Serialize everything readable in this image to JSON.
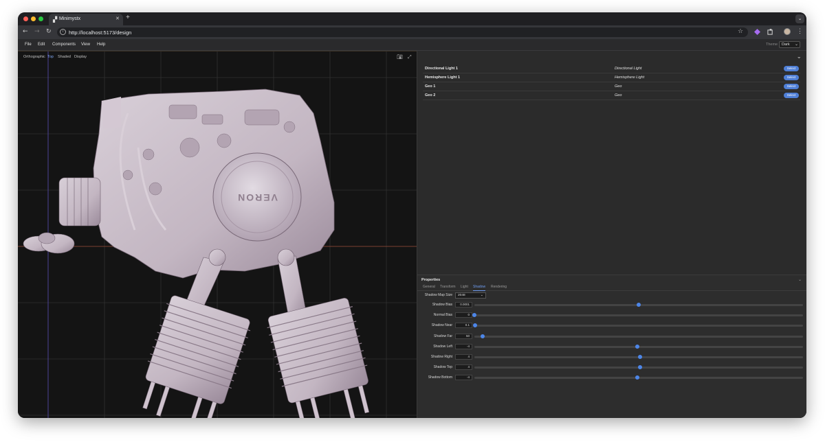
{
  "browser": {
    "tab_title": "Minimystx",
    "url": "http://localhost:5173/design"
  },
  "menubar": {
    "items": [
      "File",
      "Edit",
      "Components",
      "View",
      "Help"
    ],
    "theme_label": "Theme",
    "theme_value": "Dark"
  },
  "viewport": {
    "modes": [
      "Orthographic",
      "Top",
      "Shaded",
      "Display"
    ],
    "active_mode": "Top",
    "engine_brand": "VERON"
  },
  "scene": {
    "objects": [
      {
        "name": "Directional Light 1",
        "type": "Directional Light",
        "action": "Select"
      },
      {
        "name": "Hemisphere Light 1",
        "type": "Hemisphere Light",
        "action": "Select"
      },
      {
        "name": "Geo 1",
        "type": "Geo",
        "action": "Select"
      },
      {
        "name": "Geo 2",
        "type": "Geo",
        "action": "Select"
      }
    ]
  },
  "properties": {
    "title": "Properties",
    "tabs": [
      "General",
      "Transform",
      "Light",
      "Shadow",
      "Rendering"
    ],
    "active_tab": "Shadow",
    "shadow_map_size_label": "Shadow Map Size",
    "shadow_map_size_value": "2048",
    "rows": [
      {
        "label": "Shadow Bias",
        "value": "0.0001",
        "fraction": 0.5
      },
      {
        "label": "Normal Bias",
        "value": "0",
        "fraction": 0.0
      },
      {
        "label": "Shadow Near",
        "value": "0.1",
        "fraction": 0.002
      },
      {
        "label": "Shadow Far",
        "value": "50",
        "fraction": 0.025
      },
      {
        "label": "Shadow Left",
        "value": "-4",
        "fraction": 0.495
      },
      {
        "label": "Shadow Right",
        "value": "4",
        "fraction": 0.505
      },
      {
        "label": "Shadow Top",
        "value": "4",
        "fraction": 0.505
      },
      {
        "label": "Shadow Bottom",
        "value": "-4",
        "fraction": 0.495
      }
    ]
  },
  "colors": {
    "accent": "#4f7fd6",
    "viewport_bg": "#141414",
    "panel_bg": "#2b2b2b",
    "model": "#c9bcc7"
  }
}
